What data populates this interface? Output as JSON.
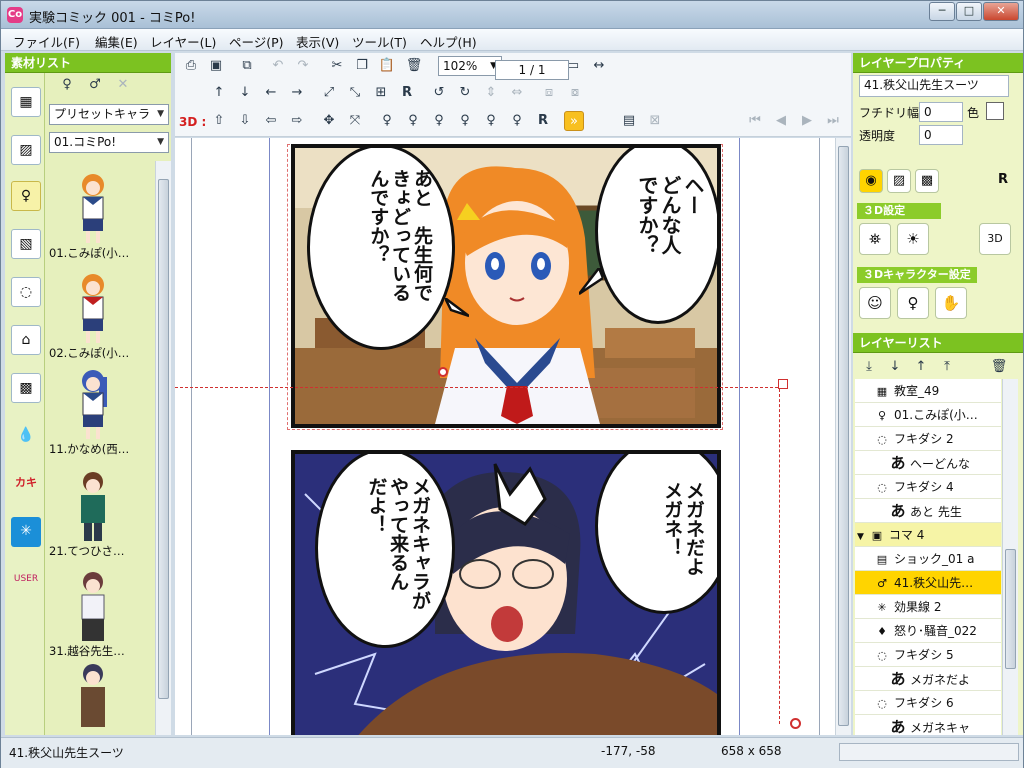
{
  "window": {
    "title": "実験コミック 001 - コミPo!",
    "app_icon": "Co",
    "min": "─",
    "max": "□",
    "close": "✕"
  },
  "menu": [
    "ファイル(F)",
    "編集(E)",
    "レイヤー(L)",
    "ページ(P)",
    "表示(V)",
    "ツール(T)",
    "ヘルプ(H)"
  ],
  "left": {
    "header": "素材リスト",
    "dropdown1": "プリセットキャラ",
    "dropdown2": "01.コミPo!",
    "characters": [
      "01.こみぽ(小…",
      "02.こみぽ(小…",
      "11.かなめ(西…",
      "21.てつひさ…",
      "31.越谷先生…"
    ],
    "hair_colors": [
      "#e88a2a",
      "#e88a2a",
      "#3b5bb8",
      "#6a3d24",
      "#6b3c3c"
    ]
  },
  "toolbar": {
    "zoom": "102%",
    "page": "1 / 1",
    "label_3d": "3D :"
  },
  "comic": {
    "panel1_right": "ヘー\nどんな人\nですか？",
    "panel1_left": "あと　先生何で\nきょどっている\nんですか？",
    "panel2_right": "メガネだよ\nメガネ！",
    "panel2_left": "メガネキャラが\nやって来るん\nだよ！"
  },
  "right": {
    "prop_header": "レイヤープロパティ",
    "layer_name": "41.秩父山先生スーツ",
    "border_label": "フチドリ幅",
    "border_value": "0",
    "color_label": "色",
    "opacity_label": "透明度",
    "opacity_value": "0",
    "section_3d": "３D設定",
    "section_3dchar": "３Dキャラクター設定",
    "layer_list_header": "レイヤーリスト",
    "layers": [
      {
        "label": "教室_49",
        "icon": "▦",
        "indent": 1
      },
      {
        "label": "01.こみぽ(小…",
        "icon": "♀",
        "indent": 1
      },
      {
        "label": "フキダシ 2",
        "icon": "◌",
        "indent": 1
      },
      {
        "label": "へーどんな",
        "icon": "あ",
        "indent": 2
      },
      {
        "label": "フキダシ 4",
        "icon": "◌",
        "indent": 1
      },
      {
        "label": "あと 先生",
        "icon": "あ",
        "indent": 2
      },
      {
        "label": "コマ 4",
        "icon": "▣",
        "indent": 0,
        "group": true
      },
      {
        "label": "ショック_01 a",
        "icon": "▤",
        "indent": 1
      },
      {
        "label": "41.秩父山先…",
        "icon": "♂",
        "indent": 1,
        "selected": true
      },
      {
        "label": "効果線 2",
        "icon": "✳",
        "indent": 1
      },
      {
        "label": "怒り･騒音_022",
        "icon": "♦",
        "indent": 1
      },
      {
        "label": "フキダシ 5",
        "icon": "◌",
        "indent": 1
      },
      {
        "label": "メガネだよ",
        "icon": "あ",
        "indent": 2
      },
      {
        "label": "フキダシ 6",
        "icon": "◌",
        "indent": 1
      },
      {
        "label": "メガネキャ",
        "icon": "あ",
        "indent": 2
      }
    ]
  },
  "status": {
    "layer": "41.秩父山先生スーツ",
    "coords": "-177, -58",
    "size": "658 x 658"
  },
  "colors": {
    "green_header": "#7cc221",
    "selected": "#ffd400",
    "bubble_border": "#111111"
  }
}
